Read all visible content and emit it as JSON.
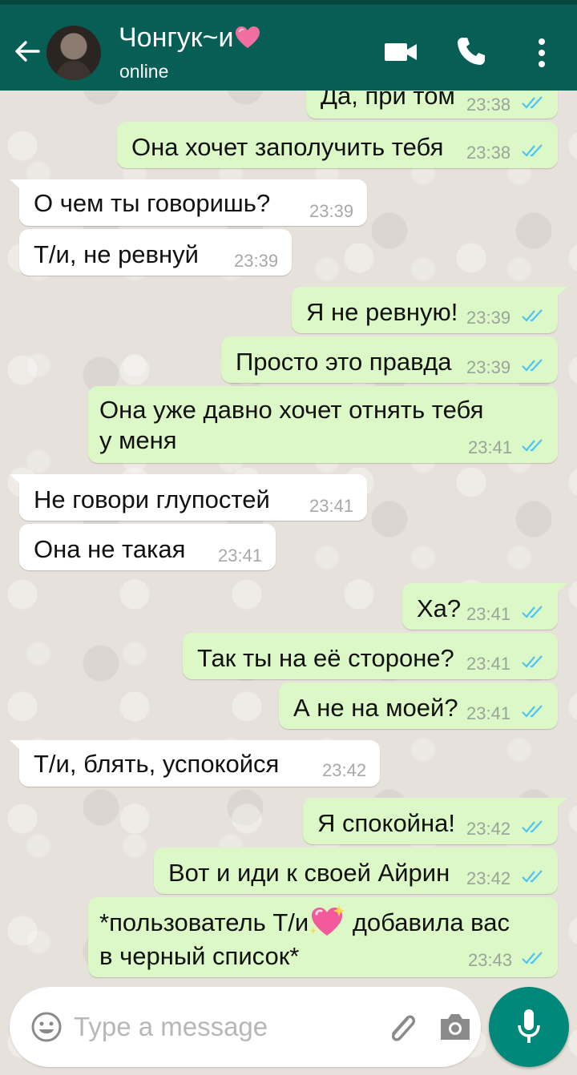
{
  "header": {
    "contact_name": "Чонгук~и",
    "status": "online"
  },
  "messages": [
    {
      "text": "Да, при том",
      "time": "23:38"
    },
    {
      "text": "Она хочет заполучить тебя",
      "time": "23:38"
    },
    {
      "text": "О чем ты говоришь?",
      "time": "23:39"
    },
    {
      "text": "Т/и, не ревнуй",
      "time": "23:39"
    },
    {
      "text": "Я не ревную!",
      "time": "23:39"
    },
    {
      "text": "Просто это правда",
      "time": "23:39"
    },
    {
      "text": "Она уже давно хочет отнять тебя\nу меня",
      "time": "23:41"
    },
    {
      "text": "Не говори глупостей",
      "time": "23:41"
    },
    {
      "text": "Она не такая",
      "time": "23:41"
    },
    {
      "text": "Ха?",
      "time": "23:41"
    },
    {
      "text": "Так ты на её стороне?",
      "time": "23:41"
    },
    {
      "text": "А не на моей?",
      "time": "23:41"
    },
    {
      "text": "Т/и, блять, успокойся",
      "time": "23:42"
    },
    {
      "text": "Я спокойна!",
      "time": "23:42"
    },
    {
      "text": "Вот и иди к своей Айрин",
      "time": "23:42"
    },
    {
      "text_before_emoji": "*пользователь Т/и",
      "text_after_emoji": "добавила вас",
      "text_line2": "в черный список*",
      "time": "23:43"
    }
  ],
  "input": {
    "placeholder": "Type a message"
  },
  "colors": {
    "header": "#075e54",
    "outgoing_bubble": "#dcf8c6",
    "incoming_bubble": "#ffffff",
    "read_ticks": "#4fc3f7",
    "mic_button": "#00897b"
  },
  "icons": [
    "back-arrow-icon",
    "avatar",
    "heart-emoji",
    "video-call-icon",
    "phone-call-icon",
    "more-options-icon",
    "read-ticks-icon",
    "sparkling-heart-emoji",
    "emoji-icon",
    "attach-icon",
    "camera-icon",
    "mic-icon"
  ]
}
